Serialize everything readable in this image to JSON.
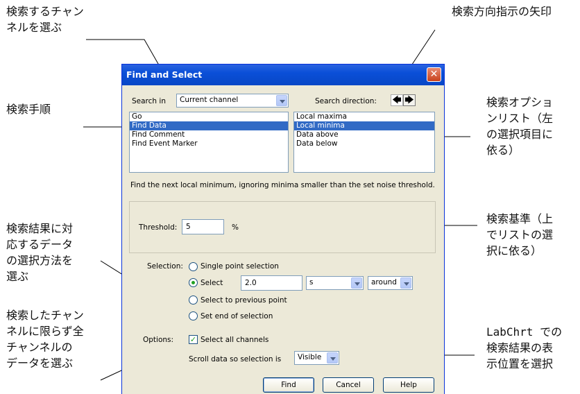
{
  "annotations": {
    "channel": "検索するチャン\nネルを選ぶ",
    "direction": "検索方向指示の矢印",
    "procedure": "検索手順",
    "options_list": "検索オプショ\nンリスト（左\nの選択項目に\n依る）",
    "criteria": "検索基準（上\nでリストの選\n択に依る）",
    "selection_method": "検索結果に対\n応するデータ\nの選択方法を\n選ぶ",
    "all_channels": "検索したチャン\nネルに限らず全\nチャンネルの\nデータを選ぶ",
    "display_position": "LabChrt での\n検索結果の表\n示位置を選択"
  },
  "dialog": {
    "title": "Find and Select",
    "close_glyph": "✕",
    "search_in_label": "Search in",
    "search_in_value": "Current channel",
    "search_direction_label": "Search direction:",
    "direction_left": "🡄",
    "direction_right": "🡆",
    "procedures": [
      "Go",
      "Find Data",
      "Find Comment",
      "Find Event Marker"
    ],
    "procedure_selected": 1,
    "options": [
      "Local maxima",
      "Local minima",
      "Data above",
      "Data below"
    ],
    "option_selected": 1,
    "description": "Find the next local minimum, ignoring minima smaller than the set noise threshold.",
    "threshold_label": "Threshold:",
    "threshold_value": "5",
    "threshold_unit": "%",
    "selection_label": "Selection:",
    "radio_single": "Single point selection",
    "radio_select": "Select",
    "select_value": "2.0",
    "select_unit": "s",
    "select_around": "around",
    "radio_previous": "Select to previous point",
    "radio_end": "Set end of selection",
    "options_label": "Options:",
    "check_all_channels": "Select all channels",
    "check_mark": "✓",
    "scroll_label": "Scroll data so selection is",
    "scroll_value": "Visible",
    "btn_find": "Find",
    "btn_cancel": "Cancel",
    "btn_help": "Help"
  }
}
